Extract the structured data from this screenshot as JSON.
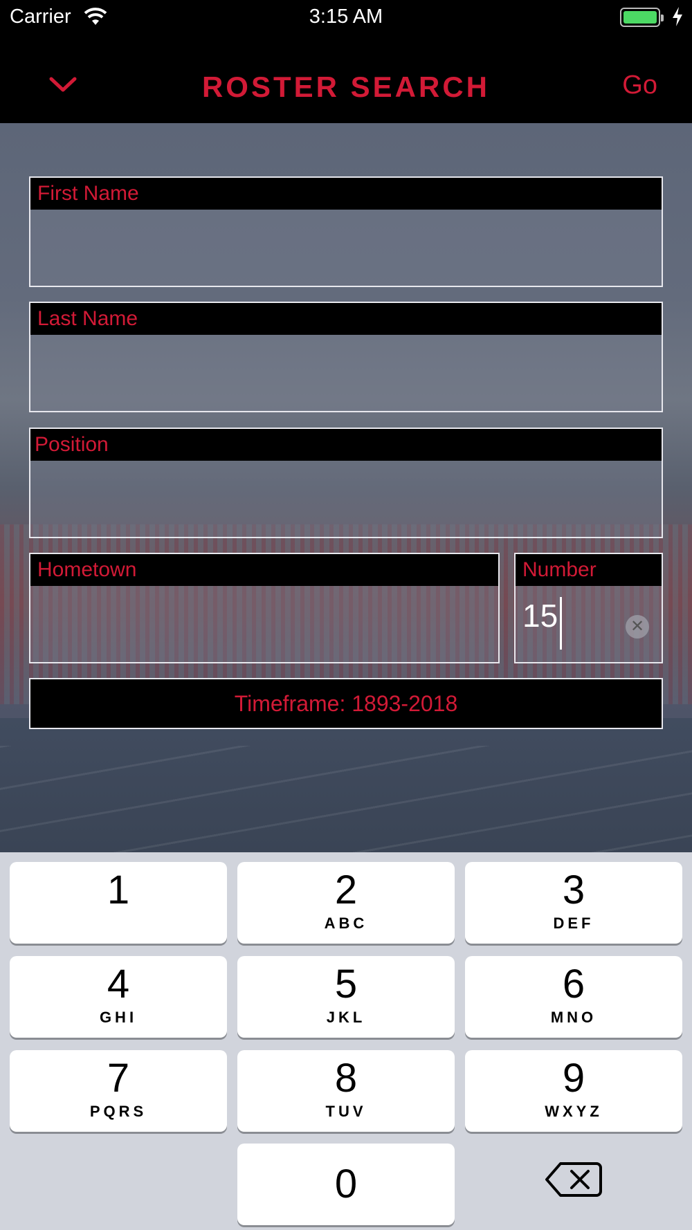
{
  "status_bar": {
    "carrier": "Carrier",
    "time": "3:15 AM"
  },
  "nav": {
    "title": "ROSTER SEARCH",
    "go_label": "Go"
  },
  "form": {
    "first_name_label": "First Name",
    "last_name_label": "Last Name",
    "position_label": "Position",
    "hometown_label": "Hometown",
    "number_label": "Number",
    "number_value": "15",
    "timeframe_label": "Timeframe: 1893-2018"
  },
  "keypad": {
    "keys": [
      {
        "digit": "1",
        "letters": ""
      },
      {
        "digit": "2",
        "letters": "ABC"
      },
      {
        "digit": "3",
        "letters": "DEF"
      },
      {
        "digit": "4",
        "letters": "GHI"
      },
      {
        "digit": "5",
        "letters": "JKL"
      },
      {
        "digit": "6",
        "letters": "MNO"
      },
      {
        "digit": "7",
        "letters": "PQRS"
      },
      {
        "digit": "8",
        "letters": "TUV"
      },
      {
        "digit": "9",
        "letters": "WXYZ"
      },
      {
        "digit": "0",
        "letters": ""
      }
    ]
  },
  "colors": {
    "accent": "#d21a36",
    "nav_background": "#000000",
    "keypad_background": "#d1d4dc"
  }
}
